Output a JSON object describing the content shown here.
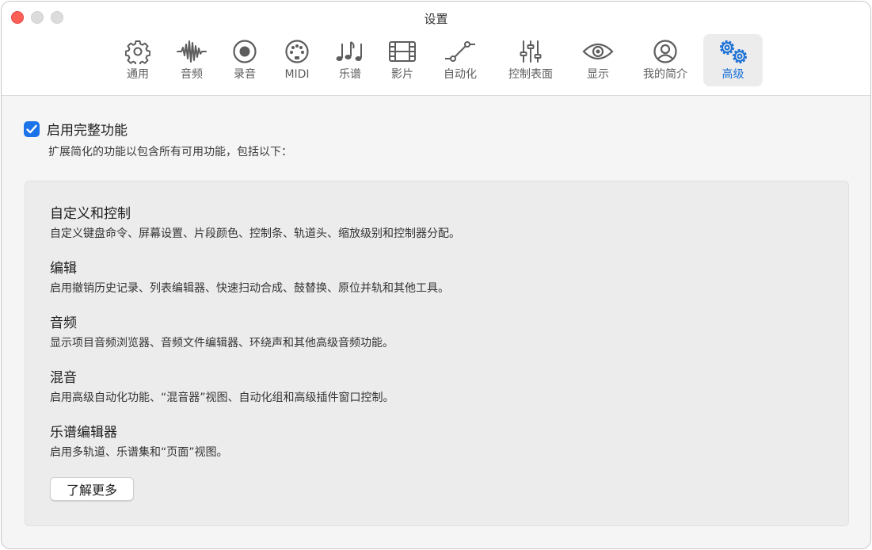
{
  "window": {
    "title": "设置"
  },
  "toolbar": {
    "tabs": [
      {
        "label": "通用",
        "icon": "gear-icon"
      },
      {
        "label": "音频",
        "icon": "waveform-icon"
      },
      {
        "label": "录音",
        "icon": "record-icon"
      },
      {
        "label": "MIDI",
        "icon": "midi-port-icon"
      },
      {
        "label": "乐谱",
        "icon": "music-notes-icon"
      },
      {
        "label": "影片",
        "icon": "film-icon"
      },
      {
        "label": "自动化",
        "icon": "automation-curve-icon"
      },
      {
        "label": "控制表面",
        "icon": "sliders-icon"
      },
      {
        "label": "显示",
        "icon": "eye-icon"
      },
      {
        "label": "我的简介",
        "icon": "person-circle-icon"
      },
      {
        "label": "高级",
        "icon": "gears-icon",
        "selected": true
      }
    ]
  },
  "advanced": {
    "enable_label": "启用完整功能",
    "enable_checked": true,
    "enable_desc": "扩展简化的功能以包含所有可用功能，包括以下：",
    "sections": [
      {
        "title": "自定义和控制",
        "desc": "自定义键盘命令、屏幕设置、片段颜色、控制条、轨道头、缩放级别和控制器分配。"
      },
      {
        "title": "编辑",
        "desc": "启用撤销历史记录、列表编辑器、快速扫动合成、鼓替换、原位并轨和其他工具。"
      },
      {
        "title": "音频",
        "desc": "显示项目音频浏览器、音频文件编辑器、环绕声和其他高级音频功能。"
      },
      {
        "title": "混音",
        "desc": "启用高级自动化功能、“混音器”视图、自动化组和高级插件窗口控制。"
      },
      {
        "title": "乐谱编辑器",
        "desc": "启用多轨道、乐谱集和“页面”视图。"
      }
    ],
    "learn_more": "了解更多"
  },
  "colors": {
    "accent": "#1a73e8",
    "close": "#ff5f57"
  }
}
